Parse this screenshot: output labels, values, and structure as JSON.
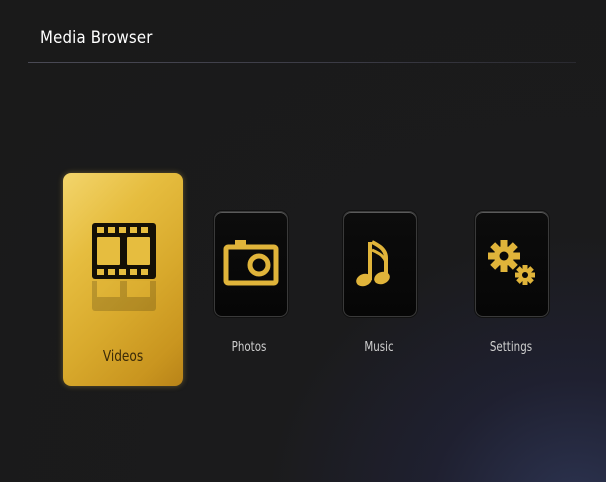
{
  "app": {
    "title": "Media Browser"
  },
  "menu": {
    "items": [
      {
        "label": "Videos",
        "icon": "film-strip-icon",
        "selected": true
      },
      {
        "label": "Photos",
        "icon": "camera-icon",
        "selected": false
      },
      {
        "label": "Music",
        "icon": "music-note-icon",
        "selected": false
      },
      {
        "label": "Settings",
        "icon": "gears-icon",
        "selected": false
      }
    ]
  },
  "colors": {
    "background": "#1a1a1a",
    "accent_gold": "#e0b43a",
    "tile_background": "#080808",
    "title_text": "#ffffff",
    "label_text": "#cfcfcf"
  }
}
